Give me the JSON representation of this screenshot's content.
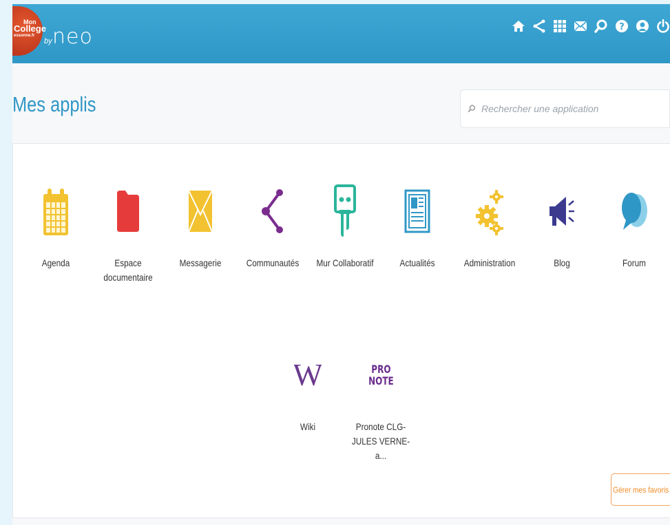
{
  "header": {
    "logo": {
      "line1": "Mon",
      "line2": "College",
      "line3": "essonne.fr",
      "by": "by",
      "brand": "neo"
    },
    "nav_icons": [
      "home-icon",
      "share-icon",
      "apps-grid-icon",
      "mail-icon",
      "search-icon",
      "help-icon",
      "user-icon",
      "power-icon"
    ]
  },
  "main": {
    "title": "Mes applis",
    "search": {
      "placeholder": "Rechercher une application",
      "value": ""
    }
  },
  "apps": [
    {
      "label": "Agenda",
      "icon": "calendar-icon",
      "color": "#f2c230"
    },
    {
      "label": "Espace documentaire",
      "icon": "folder-icon",
      "color": "#e63b3b"
    },
    {
      "label": "Messagerie",
      "icon": "envelope-icon",
      "color": "#f2c230"
    },
    {
      "label": "Communautés",
      "icon": "community-share-icon",
      "color": "#7b2d8e"
    },
    {
      "label": "Mur Collaboratif",
      "icon": "collab-wall-icon",
      "color": "#2bb59a"
    },
    {
      "label": "Actualités",
      "icon": "newspaper-icon",
      "color": "#2f97c6"
    },
    {
      "label": "Administration",
      "icon": "gears-icon",
      "color": "#f2c230"
    },
    {
      "label": "Blog",
      "icon": "megaphone-icon",
      "color": "#3b3a8f"
    },
    {
      "label": "Forum",
      "icon": "chat-bubbles-icon",
      "color": "#2f97c6"
    },
    {
      "label": "Wiki",
      "icon": "wiki-w-icon",
      "color": "#6b3a8f"
    },
    {
      "label": "Pronote CLG-\nJULES VERNE-a...",
      "icon": "pronote-icon",
      "color": "#6b2d8e",
      "text_lines": [
        "PRO",
        "NOTE"
      ]
    }
  ],
  "favorites_button": "Gérer mes favoris"
}
